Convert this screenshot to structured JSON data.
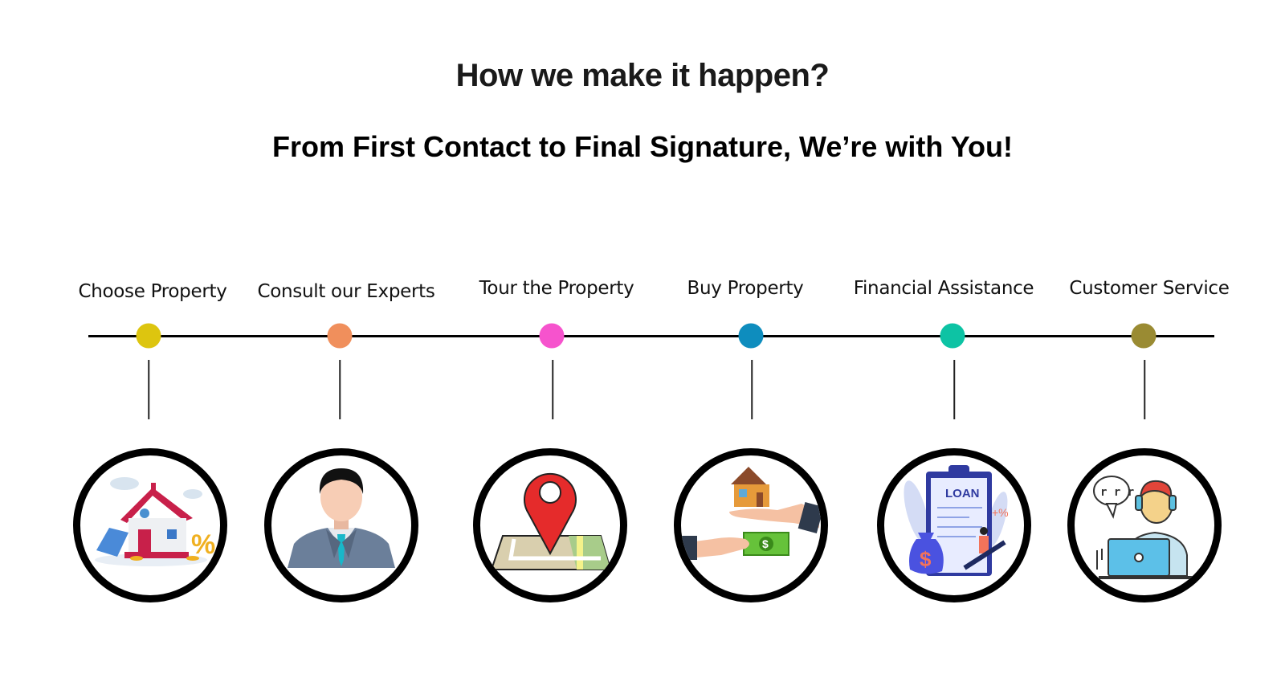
{
  "header": {
    "title": "How we make it happen?",
    "subtitle": "From First Contact to Final Signature, We’re with You!"
  },
  "steps": [
    {
      "label": "Choose Property",
      "color": "#DDC50F",
      "icon": "house-with-calculator-icon"
    },
    {
      "label": "Consult our Experts",
      "color": "#F08F5C",
      "icon": "business-expert-icon"
    },
    {
      "label": "Tour the Property",
      "color": "#F653CD",
      "icon": "map-location-pin-icon"
    },
    {
      "label": "Buy Property",
      "color": "#0E8DBE",
      "icon": "house-for-money-exchange-icon"
    },
    {
      "label": "Financial Assistance",
      "color": "#0DC3A4",
      "icon": "loan-document-icon"
    },
    {
      "label": "Customer Service",
      "color": "#9A8B33",
      "icon": "support-agent-icon"
    }
  ],
  "icon_text": {
    "loan": "LOAN",
    "percent": "%",
    "plus_percent": "+%",
    "dollar": "$"
  }
}
